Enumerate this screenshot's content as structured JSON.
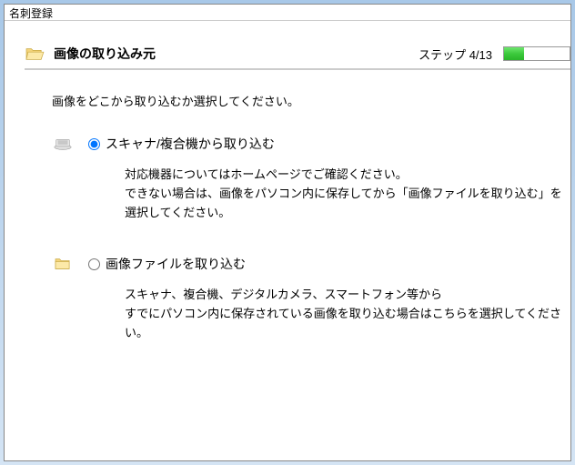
{
  "window": {
    "title": "名刺登録"
  },
  "header": {
    "title": "画像の取り込み元",
    "step_label": "ステップ 4/13"
  },
  "instruction": "画像をどこから取り込むか選択してください。",
  "options": {
    "scanner": {
      "label": "スキャナ/複合機から取り込む",
      "description_line1": "対応機器についてはホームページでご確認ください。",
      "description_line2": "できない場合は、画像をパソコン内に保存してから「画像ファイルを取り込む」を選択してください。"
    },
    "file": {
      "label": "画像ファイルを取り込む",
      "description_line1": "スキャナ、複合機、デジタルカメラ、スマートフォン等から",
      "description_line2": "すでにパソコン内に保存されている画像を取り込む場合はこちらを選択してください。"
    }
  }
}
